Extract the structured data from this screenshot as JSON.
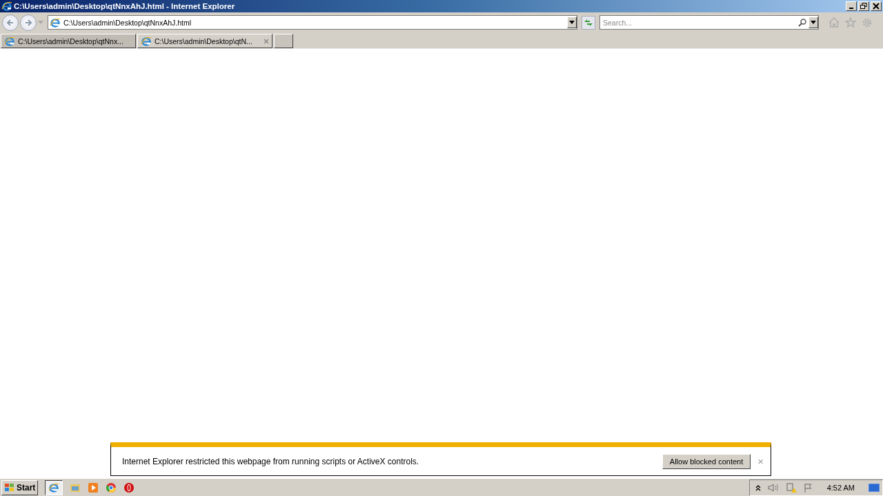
{
  "window": {
    "title": "C:\\Users\\admin\\Desktop\\qtNnxAhJ.html - Internet Explorer"
  },
  "address_bar": {
    "value": "C:\\Users\\admin\\Desktop\\qtNnxAhJ.html"
  },
  "search": {
    "placeholder": "Search..."
  },
  "tabs": [
    {
      "label": "C:\\Users\\admin\\Desktop\\qtNnx...",
      "selected": false
    },
    {
      "label": "C:\\Users\\admin\\Desktop\\qtN...",
      "selected": true
    }
  ],
  "notification": {
    "message": "Internet Explorer restricted this webpage from running scripts or ActiveX controls.",
    "button": "Allow blocked content",
    "close": "×"
  },
  "taskbar": {
    "start": "Start",
    "clock": "4:52 AM"
  }
}
